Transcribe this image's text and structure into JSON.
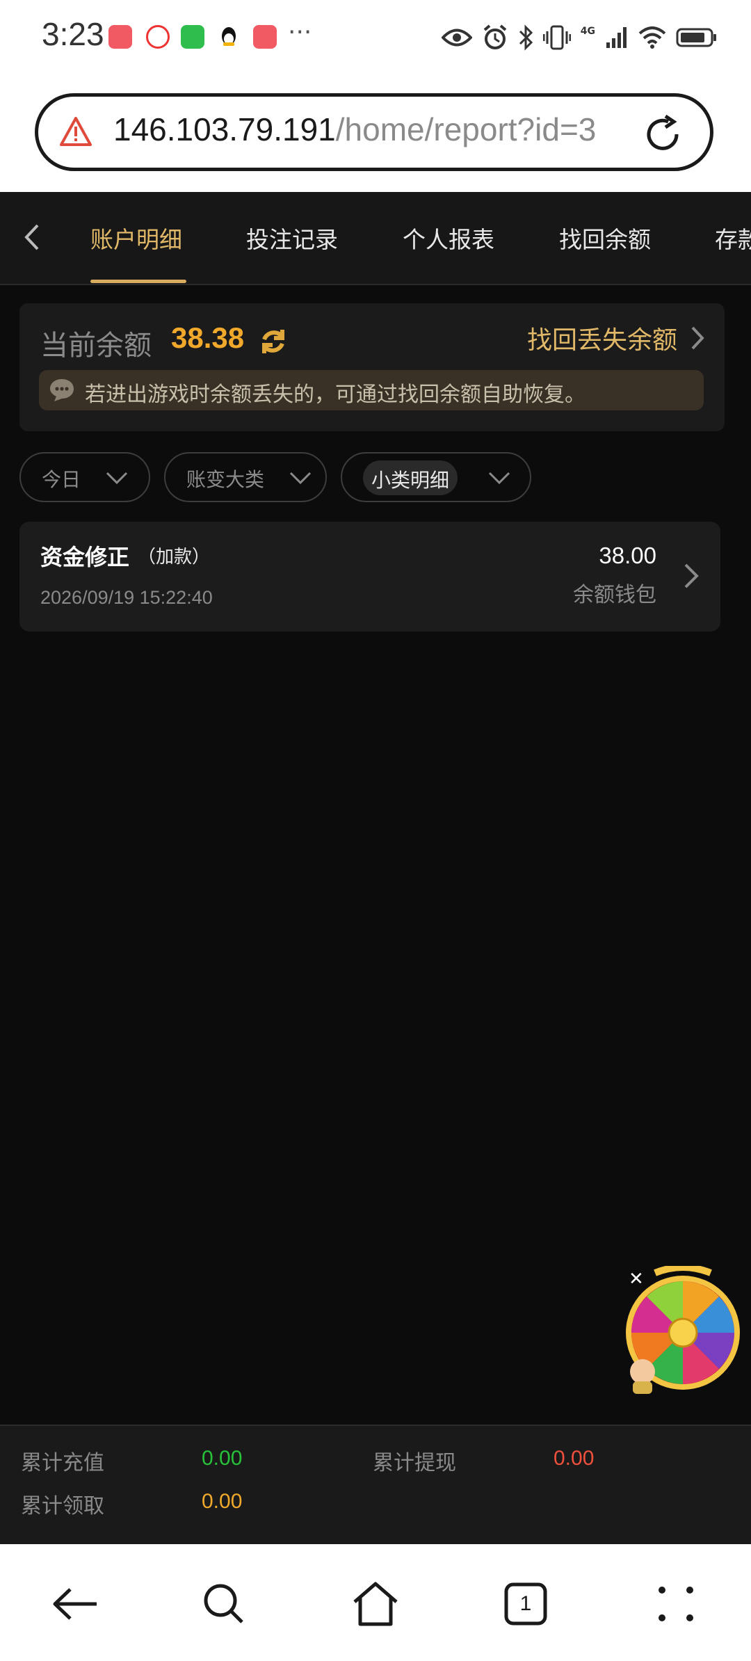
{
  "status_bar": {
    "time": "3:23",
    "more": "···",
    "network": "4G"
  },
  "browser": {
    "url_host": "146.103.79.191",
    "url_path": "/home/report?id=3"
  },
  "tabs": [
    {
      "label": "账户明细",
      "active": true
    },
    {
      "label": "投注记录",
      "active": false
    },
    {
      "label": "个人报表",
      "active": false
    },
    {
      "label": "找回余额",
      "active": false
    },
    {
      "label": "存款",
      "active": false
    }
  ],
  "balance": {
    "label": "当前余额",
    "value": "38.38",
    "recover_link": "找回丢失余额",
    "notice": "若进出游戏时余额丢失的，可通过找回余额自助恢复。"
  },
  "filters": [
    {
      "label": "今日"
    },
    {
      "label": "账变大类"
    },
    {
      "label": "小类明细"
    }
  ],
  "records": [
    {
      "title": "资金修正",
      "subtitle": "（加款）",
      "datetime": "2026/09/19 15:22:40",
      "amount": "38.00",
      "wallet": "余额钱包"
    }
  ],
  "spin_widget": {
    "close": "✕"
  },
  "summary": {
    "deposit_label": "累计充值",
    "deposit_value": "0.00",
    "withdraw_label": "累计提现",
    "withdraw_value": "0.00",
    "claim_label": "累计领取",
    "claim_value": "0.00"
  },
  "colors": {
    "accent_gold": "#e0b868",
    "balance_orange": "#f1a92b",
    "deposit_green": "#27c23a",
    "withdraw_red": "#f0503c",
    "claim_orange": "#f1a92b"
  },
  "nav": {
    "tab_count": "1"
  }
}
